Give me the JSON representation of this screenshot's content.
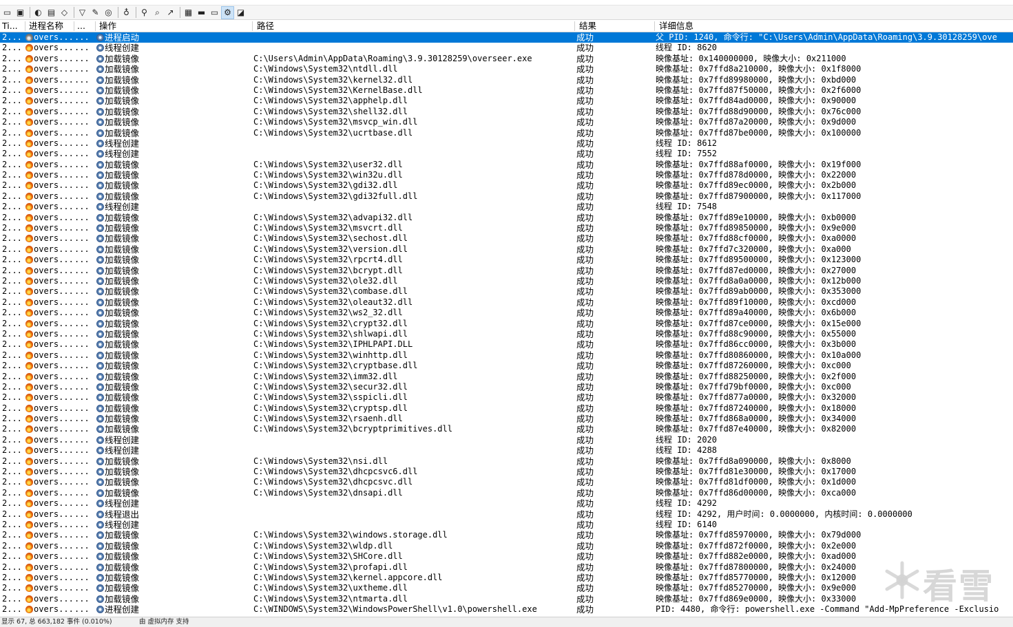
{
  "toolbar": {
    "icons": [
      "open-icon",
      "save-icon",
      "capture-icon",
      "autoscroll-icon",
      "clear-icon",
      "filter-icon",
      "highlight-icon",
      "target-icon",
      "process-tree-icon",
      "find-icon",
      "jump-icon",
      "registry-icon",
      "filesystem-icon",
      "network-icon",
      "process-activity-icon",
      "profiling-icon"
    ]
  },
  "columns": {
    "time": "Ti...",
    "process": "进程名称",
    "pid": "...",
    "operation": "操作",
    "path": "路径",
    "result": "结果",
    "detail": "详细信息"
  },
  "rows": [
    {
      "time": "2...",
      "proc": "overs...",
      "pid": "...",
      "op": "进程启动",
      "path": "",
      "res": "成功",
      "det": "父 PID: 1240, 命令行: \"C:\\Users\\Admin\\AppData\\Roaming\\3.9.30128259\\ove",
      "sel": true
    },
    {
      "time": "2...",
      "proc": "overs...",
      "pid": "...",
      "op": "线程创建",
      "path": "",
      "res": "成功",
      "det": "线程 ID: 8620"
    },
    {
      "time": "2...",
      "proc": "overs...",
      "pid": "...",
      "op": "加载镜像",
      "path": "C:\\Users\\Admin\\AppData\\Roaming\\3.9.30128259\\overseer.exe",
      "res": "成功",
      "det": "映像基址: 0x140000000, 映像大小: 0x211000"
    },
    {
      "time": "2...",
      "proc": "overs...",
      "pid": "...",
      "op": "加载镜像",
      "path": "C:\\Windows\\System32\\ntdll.dll",
      "res": "成功",
      "det": "映像基址: 0x7ffd8a210000, 映像大小: 0x1f8000"
    },
    {
      "time": "2...",
      "proc": "overs...",
      "pid": "...",
      "op": "加载镜像",
      "path": "C:\\Windows\\System32\\kernel32.dll",
      "res": "成功",
      "det": "映像基址: 0x7ffd89980000, 映像大小: 0xbd000"
    },
    {
      "time": "2...",
      "proc": "overs...",
      "pid": "...",
      "op": "加载镜像",
      "path": "C:\\Windows\\System32\\KernelBase.dll",
      "res": "成功",
      "det": "映像基址: 0x7ffd87f50000, 映像大小: 0x2f6000"
    },
    {
      "time": "2...",
      "proc": "overs...",
      "pid": "...",
      "op": "加载镜像",
      "path": "C:\\Windows\\System32\\apphelp.dll",
      "res": "成功",
      "det": "映像基址: 0x7ffd84ad0000, 映像大小: 0x90000"
    },
    {
      "time": "2...",
      "proc": "overs...",
      "pid": "...",
      "op": "加载镜像",
      "path": "C:\\Windows\\System32\\shell32.dll",
      "res": "成功",
      "det": "映像基址: 0x7ffd88d90000, 映像大小: 0x76c000"
    },
    {
      "time": "2...",
      "proc": "overs...",
      "pid": "...",
      "op": "加载镜像",
      "path": "C:\\Windows\\System32\\msvcp_win.dll",
      "res": "成功",
      "det": "映像基址: 0x7ffd87a20000, 映像大小: 0x9d000"
    },
    {
      "time": "2...",
      "proc": "overs...",
      "pid": "...",
      "op": "加载镜像",
      "path": "C:\\Windows\\System32\\ucrtbase.dll",
      "res": "成功",
      "det": "映像基址: 0x7ffd87be0000, 映像大小: 0x100000"
    },
    {
      "time": "2...",
      "proc": "overs...",
      "pid": "...",
      "op": "线程创建",
      "path": "",
      "res": "成功",
      "det": "线程 ID: 8612"
    },
    {
      "time": "2...",
      "proc": "overs...",
      "pid": "...",
      "op": "线程创建",
      "path": "",
      "res": "成功",
      "det": "线程 ID: 7552"
    },
    {
      "time": "2...",
      "proc": "overs...",
      "pid": "...",
      "op": "加载镜像",
      "path": "C:\\Windows\\System32\\user32.dll",
      "res": "成功",
      "det": "映像基址: 0x7ffd88af0000, 映像大小: 0x19f000"
    },
    {
      "time": "2...",
      "proc": "overs...",
      "pid": "...",
      "op": "加载镜像",
      "path": "C:\\Windows\\System32\\win32u.dll",
      "res": "成功",
      "det": "映像基址: 0x7ffd878d0000, 映像大小: 0x22000"
    },
    {
      "time": "2...",
      "proc": "overs...",
      "pid": "...",
      "op": "加载镜像",
      "path": "C:\\Windows\\System32\\gdi32.dll",
      "res": "成功",
      "det": "映像基址: 0x7ffd89ec0000, 映像大小: 0x2b000"
    },
    {
      "time": "2...",
      "proc": "overs...",
      "pid": "...",
      "op": "加载镜像",
      "path": "C:\\Windows\\System32\\gdi32full.dll",
      "res": "成功",
      "det": "映像基址: 0x7ffd87900000, 映像大小: 0x117000"
    },
    {
      "time": "2...",
      "proc": "overs...",
      "pid": "...",
      "op": "线程创建",
      "path": "",
      "res": "成功",
      "det": "线程 ID: 7548"
    },
    {
      "time": "2...",
      "proc": "overs...",
      "pid": "...",
      "op": "加载镜像",
      "path": "C:\\Windows\\System32\\advapi32.dll",
      "res": "成功",
      "det": "映像基址: 0x7ffd89e10000, 映像大小: 0xb0000"
    },
    {
      "time": "2...",
      "proc": "overs...",
      "pid": "...",
      "op": "加载镜像",
      "path": "C:\\Windows\\System32\\msvcrt.dll",
      "res": "成功",
      "det": "映像基址: 0x7ffd89850000, 映像大小: 0x9e000"
    },
    {
      "time": "2...",
      "proc": "overs...",
      "pid": "...",
      "op": "加载镜像",
      "path": "C:\\Windows\\System32\\sechost.dll",
      "res": "成功",
      "det": "映像基址: 0x7ffd88cf0000, 映像大小: 0xa0000"
    },
    {
      "time": "2...",
      "proc": "overs...",
      "pid": "...",
      "op": "加载镜像",
      "path": "C:\\Windows\\System32\\version.dll",
      "res": "成功",
      "det": "映像基址: 0x7ffd7c320000, 映像大小: 0xa000"
    },
    {
      "time": "2...",
      "proc": "overs...",
      "pid": "...",
      "op": "加载镜像",
      "path": "C:\\Windows\\System32\\rpcrt4.dll",
      "res": "成功",
      "det": "映像基址: 0x7ffd89500000, 映像大小: 0x123000"
    },
    {
      "time": "2...",
      "proc": "overs...",
      "pid": "...",
      "op": "加载镜像",
      "path": "C:\\Windows\\System32\\bcrypt.dll",
      "res": "成功",
      "det": "映像基址: 0x7ffd87ed0000, 映像大小: 0x27000"
    },
    {
      "time": "2...",
      "proc": "overs...",
      "pid": "...",
      "op": "加载镜像",
      "path": "C:\\Windows\\System32\\ole32.dll",
      "res": "成功",
      "det": "映像基址: 0x7ffd8a0a0000, 映像大小: 0x12b000"
    },
    {
      "time": "2...",
      "proc": "overs...",
      "pid": "...",
      "op": "加载镜像",
      "path": "C:\\Windows\\System32\\combase.dll",
      "res": "成功",
      "det": "映像基址: 0x7ffd89ab0000, 映像大小: 0x353000"
    },
    {
      "time": "2...",
      "proc": "overs...",
      "pid": "...",
      "op": "加载镜像",
      "path": "C:\\Windows\\System32\\oleaut32.dll",
      "res": "成功",
      "det": "映像基址: 0x7ffd89f10000, 映像大小: 0xcd000"
    },
    {
      "time": "2...",
      "proc": "overs...",
      "pid": "...",
      "op": "加载镜像",
      "path": "C:\\Windows\\System32\\ws2_32.dll",
      "res": "成功",
      "det": "映像基址: 0x7ffd89a40000, 映像大小: 0x6b000"
    },
    {
      "time": "2...",
      "proc": "overs...",
      "pid": "...",
      "op": "加载镜像",
      "path": "C:\\Windows\\System32\\crypt32.dll",
      "res": "成功",
      "det": "映像基址: 0x7ffd87ce0000, 映像大小: 0x15e000"
    },
    {
      "time": "2...",
      "proc": "overs...",
      "pid": "...",
      "op": "加载镜像",
      "path": "C:\\Windows\\System32\\shlwapi.dll",
      "res": "成功",
      "det": "映像基址: 0x7ffd88c90000, 映像大小: 0x55000"
    },
    {
      "time": "2...",
      "proc": "overs...",
      "pid": "...",
      "op": "加载镜像",
      "path": "C:\\Windows\\System32\\IPHLPAPI.DLL",
      "res": "成功",
      "det": "映像基址: 0x7ffd86cc0000, 映像大小: 0x3b000"
    },
    {
      "time": "2...",
      "proc": "overs...",
      "pid": "...",
      "op": "加载镜像",
      "path": "C:\\Windows\\System32\\winhttp.dll",
      "res": "成功",
      "det": "映像基址: 0x7ffd80860000, 映像大小: 0x10a000"
    },
    {
      "time": "2...",
      "proc": "overs...",
      "pid": "...",
      "op": "加载镜像",
      "path": "C:\\Windows\\System32\\cryptbase.dll",
      "res": "成功",
      "det": "映像基址: 0x7ffd87260000, 映像大小: 0xc000"
    },
    {
      "time": "2...",
      "proc": "overs...",
      "pid": "...",
      "op": "加载镜像",
      "path": "C:\\Windows\\System32\\imm32.dll",
      "res": "成功",
      "det": "映像基址: 0x7ffd88250000, 映像大小: 0x2f000"
    },
    {
      "time": "2...",
      "proc": "overs...",
      "pid": "...",
      "op": "加载镜像",
      "path": "C:\\Windows\\System32\\secur32.dll",
      "res": "成功",
      "det": "映像基址: 0x7ffd79bf0000, 映像大小: 0xc000"
    },
    {
      "time": "2...",
      "proc": "overs...",
      "pid": "...",
      "op": "加载镜像",
      "path": "C:\\Windows\\System32\\sspicli.dll",
      "res": "成功",
      "det": "映像基址: 0x7ffd877a0000, 映像大小: 0x32000"
    },
    {
      "time": "2...",
      "proc": "overs...",
      "pid": "...",
      "op": "加载镜像",
      "path": "C:\\Windows\\System32\\cryptsp.dll",
      "res": "成功",
      "det": "映像基址: 0x7ffd87240000, 映像大小: 0x18000"
    },
    {
      "time": "2...",
      "proc": "overs...",
      "pid": "...",
      "op": "加载镜像",
      "path": "C:\\Windows\\System32\\rsaenh.dll",
      "res": "成功",
      "det": "映像基址: 0x7ffd868a0000, 映像大小: 0x34000"
    },
    {
      "time": "2...",
      "proc": "overs...",
      "pid": "...",
      "op": "加载镜像",
      "path": "C:\\Windows\\System32\\bcryptprimitives.dll",
      "res": "成功",
      "det": "映像基址: 0x7ffd87e40000, 映像大小: 0x82000"
    },
    {
      "time": "2...",
      "proc": "overs...",
      "pid": "...",
      "op": "线程创建",
      "path": "",
      "res": "成功",
      "det": "线程 ID: 2020"
    },
    {
      "time": "2...",
      "proc": "overs...",
      "pid": "...",
      "op": "线程创建",
      "path": "",
      "res": "成功",
      "det": "线程 ID: 4288"
    },
    {
      "time": "2...",
      "proc": "overs...",
      "pid": "...",
      "op": "加载镜像",
      "path": "C:\\Windows\\System32\\nsi.dll",
      "res": "成功",
      "det": "映像基址: 0x7ffd8a090000, 映像大小: 0x8000"
    },
    {
      "time": "2...",
      "proc": "overs...",
      "pid": "...",
      "op": "加载镜像",
      "path": "C:\\Windows\\System32\\dhcpcsvc6.dll",
      "res": "成功",
      "det": "映像基址: 0x7ffd81e30000, 映像大小: 0x17000"
    },
    {
      "time": "2...",
      "proc": "overs...",
      "pid": "...",
      "op": "加载镜像",
      "path": "C:\\Windows\\System32\\dhcpcsvc.dll",
      "res": "成功",
      "det": "映像基址: 0x7ffd81df0000, 映像大小: 0x1d000"
    },
    {
      "time": "2...",
      "proc": "overs...",
      "pid": "...",
      "op": "加载镜像",
      "path": "C:\\Windows\\System32\\dnsapi.dll",
      "res": "成功",
      "det": "映像基址: 0x7ffd86d00000, 映像大小: 0xca000"
    },
    {
      "time": "2...",
      "proc": "overs...",
      "pid": "...",
      "op": "线程创建",
      "path": "",
      "res": "成功",
      "det": "线程 ID: 4292"
    },
    {
      "time": "2...",
      "proc": "overs...",
      "pid": "...",
      "op": "线程退出",
      "path": "",
      "res": "成功",
      "det": "线程 ID: 4292, 用户时间: 0.0000000, 内核时间: 0.0000000"
    },
    {
      "time": "2...",
      "proc": "overs...",
      "pid": "...",
      "op": "线程创建",
      "path": "",
      "res": "成功",
      "det": "线程 ID: 6140"
    },
    {
      "time": "2...",
      "proc": "overs...",
      "pid": "...",
      "op": "加载镜像",
      "path": "C:\\Windows\\System32\\windows.storage.dll",
      "res": "成功",
      "det": "映像基址: 0x7ffd85970000, 映像大小: 0x79d000"
    },
    {
      "time": "2...",
      "proc": "overs...",
      "pid": "...",
      "op": "加载镜像",
      "path": "C:\\Windows\\System32\\wldp.dll",
      "res": "成功",
      "det": "映像基址: 0x7ffd872f0000, 映像大小: 0x2e000"
    },
    {
      "time": "2...",
      "proc": "overs...",
      "pid": "...",
      "op": "加载镜像",
      "path": "C:\\Windows\\System32\\SHCore.dll",
      "res": "成功",
      "det": "映像基址: 0x7ffd882e0000, 映像大小: 0xad000"
    },
    {
      "time": "2...",
      "proc": "overs...",
      "pid": "...",
      "op": "加载镜像",
      "path": "C:\\Windows\\System32\\profapi.dll",
      "res": "成功",
      "det": "映像基址: 0x7ffd87800000, 映像大小: 0x24000"
    },
    {
      "time": "2...",
      "proc": "overs...",
      "pid": "...",
      "op": "加载镜像",
      "path": "C:\\Windows\\System32\\kernel.appcore.dll",
      "res": "成功",
      "det": "映像基址: 0x7ffd85770000, 映像大小: 0x12000"
    },
    {
      "time": "2...",
      "proc": "overs...",
      "pid": "...",
      "op": "加载镜像",
      "path": "C:\\Windows\\System32\\uxtheme.dll",
      "res": "成功",
      "det": "映像基址: 0x7ffd85270000, 映像大小: 0x9e000"
    },
    {
      "time": "2...",
      "proc": "overs...",
      "pid": "...",
      "op": "加载镜像",
      "path": "C:\\Windows\\System32\\ntmarta.dll",
      "res": "成功",
      "det": "映像基址: 0x7ffd869e0000, 映像大小: 0x33000"
    },
    {
      "time": "2...",
      "proc": "overs...",
      "pid": "...",
      "op": "进程创建",
      "path": "C:\\WINDOWS\\System32\\WindowsPowerShell\\v1.0\\powershell.exe",
      "res": "成功",
      "det": "PID: 4480, 命令行: powershell.exe -Command \"Add-MpPreference -Exclusio"
    }
  ],
  "statusbar": {
    "events": "显示 67, 总 663,182 事件 (0.010%)",
    "memory": "由 虚拟内存 支持"
  },
  "watermark": {
    "text": "看雪"
  },
  "colors": {
    "selection": "#0078d7",
    "process_icon": "#f59a1c",
    "op_icon": "#5f86b5"
  }
}
